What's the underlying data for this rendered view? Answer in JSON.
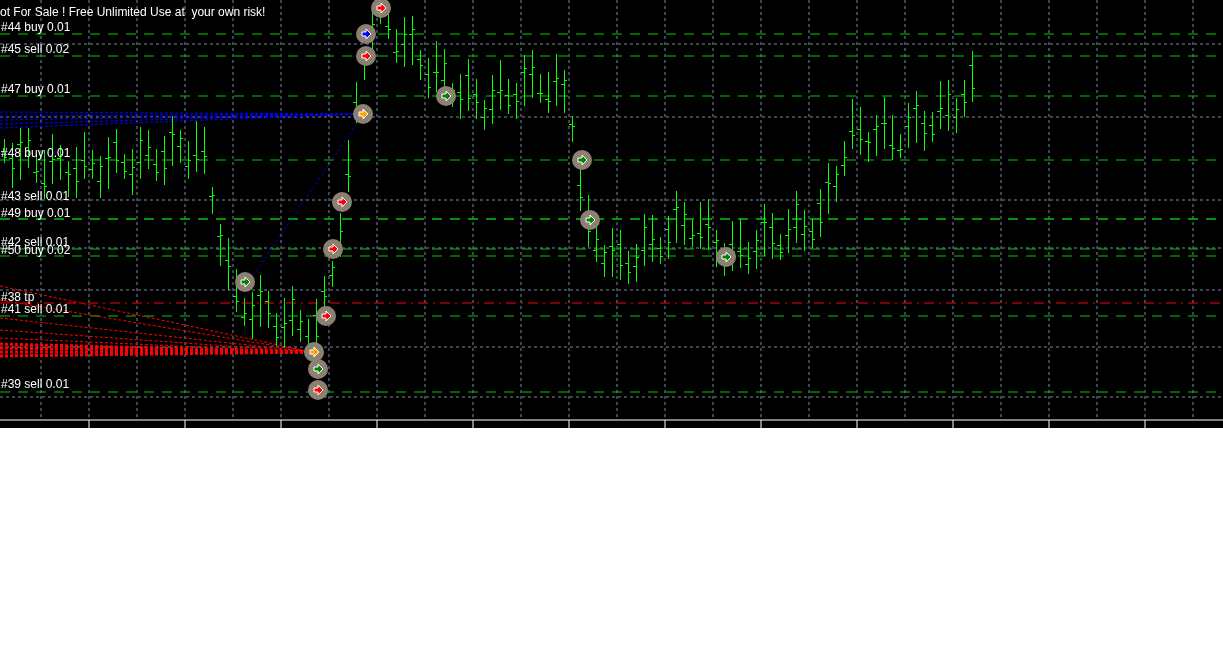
{
  "chart": {
    "banner": "ot For Sale ! Free Unlimited Use at  your own risk!",
    "order_labels": [
      {
        "text": "#44 buy 0.01",
        "kind": "buy"
      },
      {
        "text": "#45 sell 0.02",
        "kind": "sell"
      },
      {
        "text": "#47 buy 0.01",
        "kind": "buy"
      },
      {
        "text": "#48 buy 0.01",
        "kind": "buy"
      },
      {
        "text": "#43 sell 0.01",
        "kind": "sell"
      },
      {
        "text": "#49 buy 0.01",
        "kind": "buy"
      },
      {
        "text": "#42 sell 0.01",
        "kind": "sell"
      },
      {
        "text": "#50 buy 0.02",
        "kind": "buy"
      },
      {
        "text": "#38 tp",
        "kind": "tp"
      },
      {
        "text": "#41 sell 0.01",
        "kind": "sell"
      },
      {
        "text": "#39 sell 0.01",
        "kind": "sell"
      }
    ]
  }
}
